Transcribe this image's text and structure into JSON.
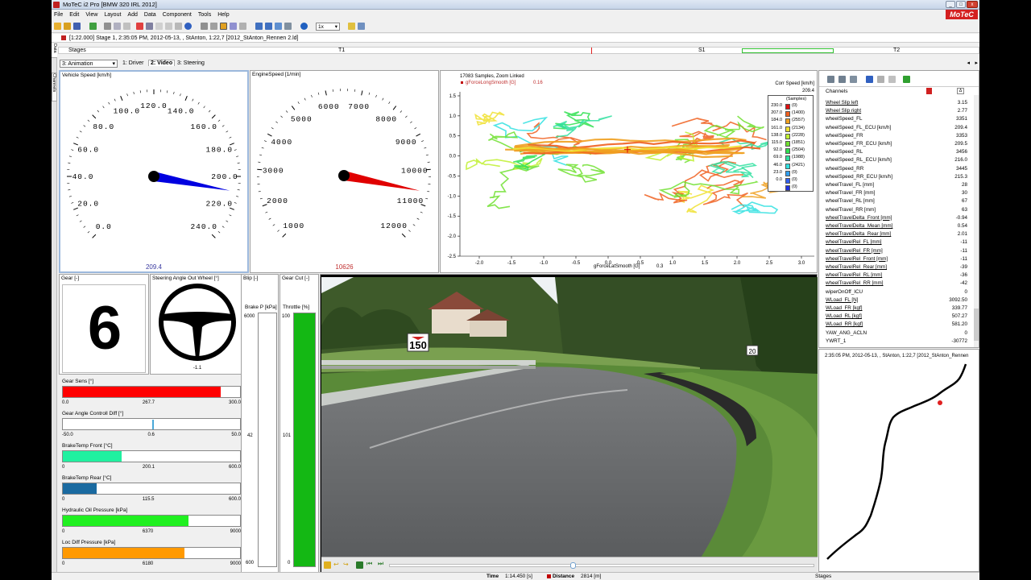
{
  "window": {
    "title": "MoTeC i2 Pro [BMW 320 IRL 2012]",
    "brand": "MoTeC"
  },
  "menu": [
    "File",
    "Edit",
    "View",
    "Layout",
    "Add",
    "Data",
    "Component",
    "Tools",
    "Help"
  ],
  "toolbar": {
    "playback_rate": "1x"
  },
  "info": "[1:22.000] Stage 1, 2:35:05 PM, 2012-05-13, , StAnton, 1:22,7 [2012_StAnton_Rennen 2.ld]",
  "left_tabs": {
    "data": "Data",
    "channels": "Channels"
  },
  "stages": {
    "label": "Stages",
    "t1": "T1",
    "s1": "S1",
    "t2": "T2"
  },
  "tabs": {
    "selector": "3: Animation",
    "items": [
      "1: Driver",
      "2: Video",
      "3: Steering"
    ]
  },
  "gauges": [
    {
      "title": "Vehicle Speed [km/h]",
      "labels": [
        "0.0",
        "20.0",
        "40.0",
        "60.0",
        "80.0",
        "100.0",
        "120.0",
        "140.0",
        "160.0",
        "180.0",
        "200.0",
        "220.0",
        "240.0"
      ],
      "min": 0,
      "max": 240,
      "value": 209.4,
      "value_text": "209.4",
      "color": "#0000e0",
      "value_color": "#3a3aa0"
    },
    {
      "title": "EngineSpeed [1/min]",
      "labels": [
        "1000",
        "2000",
        "3000",
        "4000",
        "5000",
        "6000",
        "7000",
        "8000",
        "9000",
        "10000",
        "11000",
        "12000"
      ],
      "min": 1000,
      "max": 12000,
      "value": 10626,
      "value_text": "10626",
      "color": "#e00000",
      "value_color": "#c03030"
    }
  ],
  "scatter": {
    "samples_text": "17083 Samples, Zoom Linked",
    "series_label": "gForceLongSmooth [G]",
    "series_value": "0.16",
    "xlabel": "gForceLatSmooth [G]",
    "x_value": "0.3",
    "legend": {
      "title": "Corr Speed [km/h]",
      "value": "209.4",
      "samples_title": "(Samples)",
      "entries": [
        {
          "v": "230.0",
          "n": "(0)",
          "c": "#e01010"
        },
        {
          "v": "207.0",
          "n": "(1400)",
          "c": "#f06020"
        },
        {
          "v": "184.0",
          "n": "(2557)",
          "c": "#f0a020"
        },
        {
          "v": "161.0",
          "n": "(2134)",
          "c": "#f0e030"
        },
        {
          "v": "138.0",
          "n": "(2228)",
          "c": "#c0f030"
        },
        {
          "v": "115.0",
          "n": "(1851)",
          "c": "#70e030"
        },
        {
          "v": "92.0",
          "n": "(2504)",
          "c": "#30e050"
        },
        {
          "v": "69.0",
          "n": "(1988)",
          "c": "#30e0a0"
        },
        {
          "v": "46.0",
          "n": "(2421)",
          "c": "#30e0e0"
        },
        {
          "v": "23.0",
          "n": "(0)",
          "c": "#30a0f0"
        },
        {
          "v": "0.0",
          "n": "(0)",
          "c": "#3060f0"
        },
        {
          "v": "",
          "n": "(0)",
          "c": "#2030e0"
        }
      ]
    }
  },
  "chart_data": {
    "type": "scatter",
    "title": "17083 Samples, Zoom Linked",
    "xlabel": "gForceLatSmooth [G]",
    "ylabel": "gForceLongSmooth [G]",
    "xlim": [
      -2.3,
      3.2
    ],
    "ylim": [
      -2.5,
      1.6
    ],
    "x_ticks": [
      "-2.0",
      "-1.5",
      "-1.0",
      "-0.5",
      "0.0",
      "0.5",
      "1.0",
      "1.5",
      "2.0",
      "2.5",
      "3.0"
    ],
    "y_ticks": [
      "1.5",
      "1.0",
      "0.5",
      "0.0",
      "-0.5",
      "-1.0",
      "-1.5",
      "-2.0",
      "-2.5"
    ],
    "cursor": {
      "x": 0.3,
      "y": 0.16
    },
    "grid": false
  },
  "gear": {
    "title": "Gear [-]",
    "value": "6"
  },
  "steering": {
    "title": "Steering Angle Out Wheel [°]",
    "value": "-1.1"
  },
  "blip": {
    "title": "Blip [-]"
  },
  "gearcut": {
    "title": "Gear Cut [-]"
  },
  "brakep": {
    "title": "Brake P [kPa]",
    "max": "6000",
    "mid": "42",
    "min": "600"
  },
  "throttle": {
    "title": "Throttle [%]",
    "max": "100",
    "mid": "101",
    "min": "0",
    "fraction": 1.0
  },
  "bars": [
    {
      "title": "Gear Sens [°]",
      "min": "0.0",
      "val": "267.7",
      "max": "300.0",
      "fraction": 0.892,
      "color": "#ff0000",
      "val_pos": 0.45
    },
    {
      "title": "Gear Angle Controll Diff [°]",
      "min": "-50.0",
      "val": "0.6",
      "max": "50.0",
      "fraction": 0.506,
      "color": "#4aa8d8",
      "marker": true,
      "val_pos": 0.48
    },
    {
      "title": "BrakeTemp Front [°C]",
      "min": "0",
      "val": "200.1",
      "max": "600.0",
      "fraction": 0.333,
      "color": "#20f0a0",
      "val_pos": 0.45
    },
    {
      "title": "BrakeTemp Rear [°C]",
      "min": "0",
      "val": "115.5",
      "max": "600.0",
      "fraction": 0.193,
      "color": "#1a6aa0",
      "val_pos": 0.45
    },
    {
      "title": "Hydraulic Oil Pressure [kPa]",
      "min": "0",
      "val": "6370",
      "max": "9000",
      "fraction": 0.708,
      "color": "#20f020",
      "val_pos": 0.45
    },
    {
      "title": "Loc Diff Pressure [kPa]",
      "min": "0",
      "val": "6180",
      "max": "9000",
      "fraction": 0.687,
      "color": "#ff9900",
      "val_pos": 0.45
    }
  ],
  "video": {
    "sign1": "150",
    "sign2": "20"
  },
  "channels": {
    "header": "Channels",
    "rows": [
      {
        "n": "Wheel Slip left",
        "v": "3.15"
      },
      {
        "n": "Wheel Slip right",
        "v": "2.77"
      },
      {
        "n": "wheelSpeed_FL",
        "v": "3351"
      },
      {
        "n": "wheelSpeed_FL_ECU [km/h]",
        "v": "209.4"
      },
      {
        "n": "wheelSpeed_FR",
        "v": "3353"
      },
      {
        "n": "wheelSpeed_FR_ECU [km/h]",
        "v": "209.5"
      },
      {
        "n": "wheelSpeed_RL",
        "v": "3456"
      },
      {
        "n": "wheelSpeed_RL_ECU [km/h]",
        "v": "216.0"
      },
      {
        "n": "wheelSpeed_RR",
        "v": "3445"
      },
      {
        "n": "wheelSpeed_RR_ECU [km/h]",
        "v": "215.3"
      },
      {
        "n": "wheelTravel_FL [mm]",
        "v": "28"
      },
      {
        "n": "wheelTravel_FR [mm]",
        "v": "30"
      },
      {
        "n": "wheelTravel_RL [mm]",
        "v": "67"
      },
      {
        "n": "wheelTravel_RR [mm]",
        "v": "63"
      },
      {
        "n": "wheelTravelDelta_Front [mm]",
        "v": "-0.94"
      },
      {
        "n": "wheelTravelDelta_Mean [mm]",
        "v": "0.54"
      },
      {
        "n": "wheelTravelDelta_Rear [mm]",
        "v": "2.01"
      },
      {
        "n": "wheelTravelRel_FL [mm]",
        "v": "-11"
      },
      {
        "n": "wheelTravelRel_FR [mm]",
        "v": "-11"
      },
      {
        "n": "wheelTravelRel_Front [mm]",
        "v": "-11"
      },
      {
        "n": "wheelTravelRel_Rear [mm]",
        "v": "-39"
      },
      {
        "n": "wheelTravelRel_RL [mm]",
        "v": "-36"
      },
      {
        "n": "wheelTravelRel_RR [mm]",
        "v": "-42"
      },
      {
        "n": "wiperOnOff_ICU",
        "v": "0"
      },
      {
        "n": "WLoad_FL [N]",
        "v": "3092.50"
      },
      {
        "n": "WLoad_FR [kgf]",
        "v": "339.77"
      },
      {
        "n": "WLoad_RL [kgf]",
        "v": "507.27"
      },
      {
        "n": "WLoad_RR [kgf]",
        "v": "581.20"
      },
      {
        "n": "YAW_ANG_ACLN",
        "v": "0"
      },
      {
        "n": "YWRT_1",
        "v": "-30772"
      }
    ]
  },
  "track": {
    "info": "2:35:05 PM, 2012-05-13, , StAnton, 1:22,7 [2012_StAnton_Rennen"
  },
  "status": {
    "time_label": "Time",
    "time_value": "1:14.450 [s]",
    "dist_label": "Distance",
    "dist_value": "2814 [m]",
    "stages": "Stages"
  }
}
